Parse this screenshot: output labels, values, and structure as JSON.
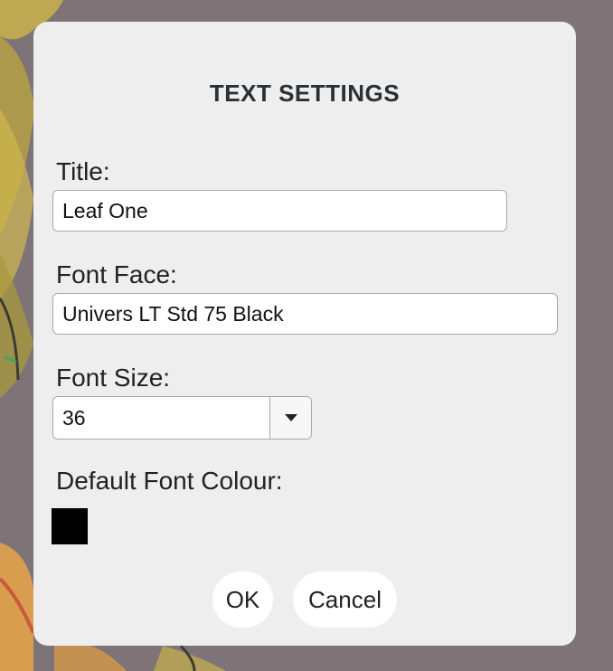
{
  "dialog": {
    "title": "TEXT SETTINGS",
    "fields": {
      "title": {
        "label": "Title:",
        "value": "Leaf One"
      },
      "font_face": {
        "label": "Font Face:",
        "value": "Univers LT Std 75 Black"
      },
      "font_size": {
        "label": "Font Size:",
        "value": "36"
      },
      "font_colour": {
        "label": "Default Font Colour:",
        "color": "#000000"
      }
    },
    "buttons": {
      "ok": "OK",
      "cancel": "Cancel"
    }
  },
  "colors": {
    "backdrop": "#7e7478",
    "dialog_bg": "#eeeeee",
    "title_text": "#2a3038"
  }
}
